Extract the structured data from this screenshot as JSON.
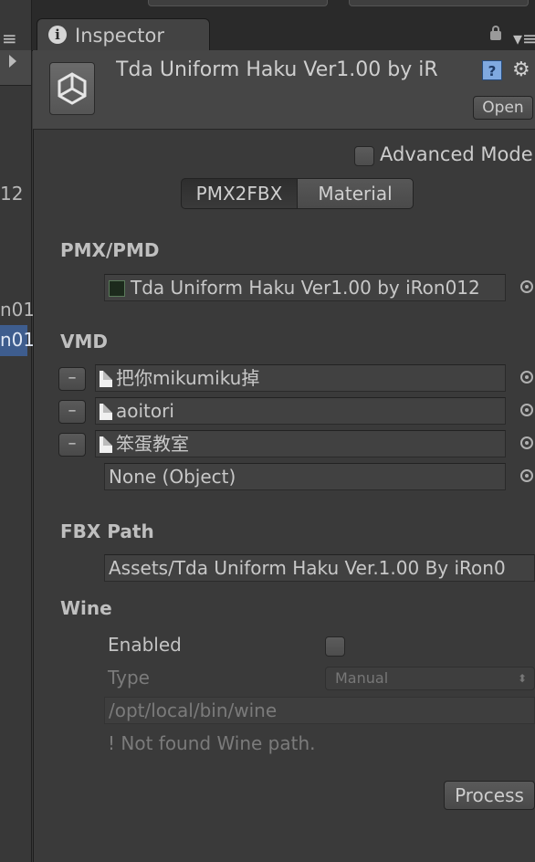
{
  "left_panel": {
    "lines": [
      "12",
      "n01",
      "n01"
    ]
  },
  "tab": {
    "label": "Inspector",
    "icon": "info-icon"
  },
  "header": {
    "title": "Tda Uniform Haku Ver1.00 by iR",
    "open_label": "Open",
    "help_glyph": "?"
  },
  "advanced_mode": {
    "label": "Advanced Mode",
    "checked": false
  },
  "tabs": {
    "left": "PMX2FBX",
    "right": "Material",
    "active": "PMX2FBX"
  },
  "pmx": {
    "label": "PMX/PMD",
    "value": "Tda Uniform Haku Ver1.00 by iRon012"
  },
  "vmd": {
    "label": "VMD",
    "minus_label": "–",
    "items": [
      "把你mikumiku掉",
      "aoitori",
      "笨蛋教室"
    ],
    "none_value": "None (Object)"
  },
  "fbx": {
    "label": "FBX Path",
    "value": "Assets/Tda Uniform Haku Ver.1.00 By iRon0"
  },
  "wine": {
    "label": "Wine",
    "enabled_label": "Enabled",
    "type_label": "Type",
    "type_value": "Manual",
    "path_value": "/opt/local/bin/wine",
    "warning": "! Not found Wine path."
  },
  "process_label": "Process",
  "colors": {
    "background": "#383838",
    "selection": "#3e5d8e",
    "help_blue": "#7fa9e0"
  }
}
